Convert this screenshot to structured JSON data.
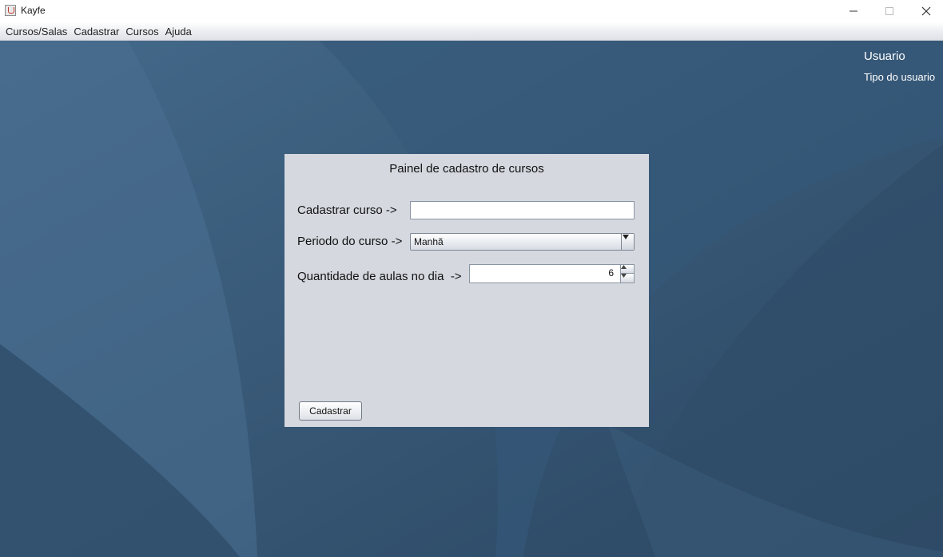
{
  "window": {
    "title": "Kayfe",
    "controls": [
      "minimize-icon",
      "maximize-icon",
      "close-icon"
    ]
  },
  "menubar": {
    "items": [
      "Cursos/Salas",
      "Cadastrar",
      "Cursos",
      "Ajuda"
    ]
  },
  "user": {
    "name": "Usuario",
    "type": "Tipo do usuario"
  },
  "panel": {
    "title": "Painel de cadastro de cursos",
    "curso_label": "Cadastrar curso ->",
    "curso_value": "",
    "periodo_label": "Periodo do curso ->",
    "periodo_selected": "Manhã",
    "quantidade_label": "Quantidade de aulas no dia  ->",
    "quantidade_value": "6",
    "submit_label": "Cadastrar"
  },
  "colors": {
    "desktop": "#3a5a78",
    "panel": "#d5d8df"
  }
}
